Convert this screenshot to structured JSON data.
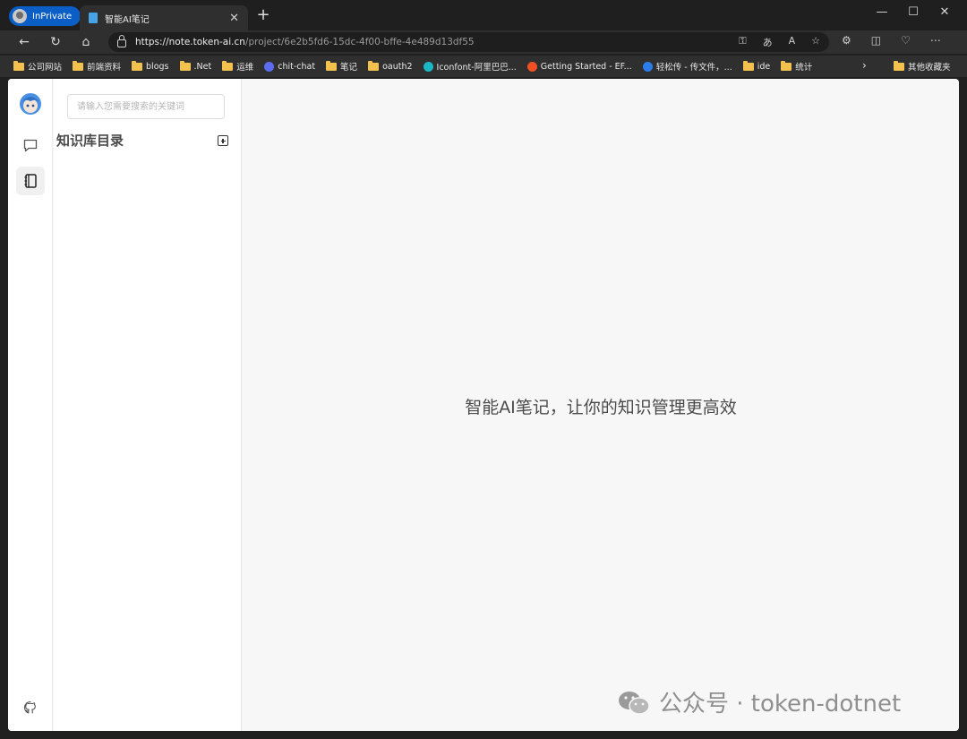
{
  "browser": {
    "inprivate_label": "InPrivate",
    "tab_title": "智能AI笔记",
    "url_host": "https://note.token-ai.cn",
    "url_path": "/project/6e2b5fd6-15dc-4f00-bffe-4e489d13df55"
  },
  "bookmarks": [
    {
      "label": "公司网站",
      "icon": "folder-icon"
    },
    {
      "label": "前端资料",
      "icon": "folder-icon"
    },
    {
      "label": "blogs",
      "icon": "folder-icon"
    },
    {
      "label": ".Net",
      "icon": "folder-icon"
    },
    {
      "label": "运维",
      "icon": "folder-icon"
    },
    {
      "label": "chit-chat",
      "icon": "site-icon"
    },
    {
      "label": "笔记",
      "icon": "folder-icon"
    },
    {
      "label": "oauth2",
      "icon": "folder-icon"
    },
    {
      "label": "Iconfont-阿里巴巴...",
      "icon": "iconfont-icon"
    },
    {
      "label": "Getting Started - EF...",
      "icon": "microsoft-icon"
    },
    {
      "label": "轻松传 - 传文件，...",
      "icon": "upload-site-icon"
    },
    {
      "label": "ide",
      "icon": "folder-icon"
    },
    {
      "label": "统计",
      "icon": "folder-icon"
    }
  ],
  "bookmarks_other": "其他收藏夹",
  "sidebar": {
    "search_placeholder": "请输入您需要搜索的关键词",
    "title": "知识库目录"
  },
  "main": {
    "hero_text": "智能AI笔记，让你的知识管理更高效"
  },
  "watermark": {
    "text": "公众号 · token-dotnet"
  },
  "colors": {
    "inprivate": "#0a5ec6",
    "page_bg": "#f7f7f7",
    "folder": "#f2c14e"
  }
}
